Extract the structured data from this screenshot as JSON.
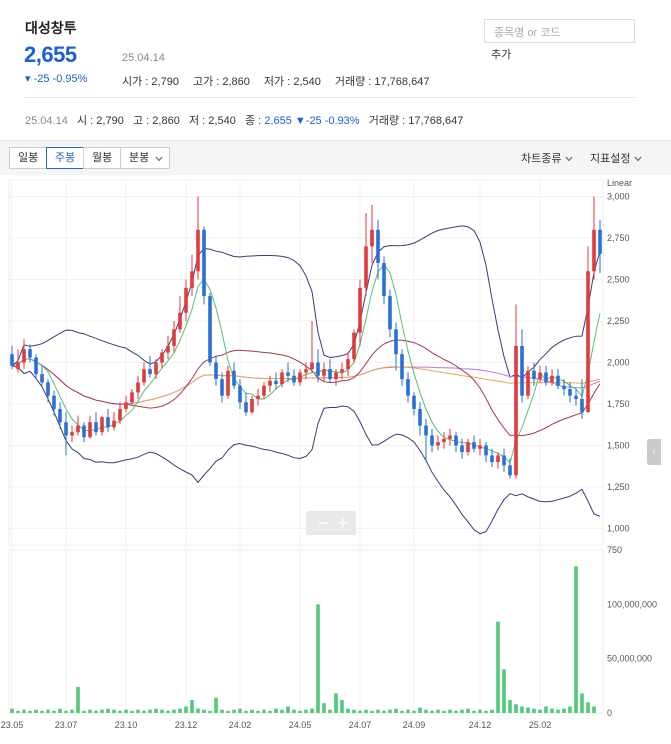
{
  "header": {
    "stock_name": "대성창투",
    "price": "2,655",
    "date": "25.04.14",
    "change": "▾ -25 -0.95%",
    "open_label": "시가 : ",
    "open": "2,790",
    "high_label": "고가 : ",
    "high": "2,860",
    "low_label": "저가 : ",
    "low": "2,540",
    "volume_label": "거래량 : ",
    "volume": "17,768,647",
    "search_placeholder": "종목명 or 코드",
    "add_label": "추가"
  },
  "summary": {
    "date": "25.04.14",
    "open": "시 : 2,790",
    "high": "고 : 2,860",
    "low": "저 : 2,540",
    "close_label": "종 : ",
    "close": "2,655",
    "change": "▼-25 -0.93%",
    "volume": "거래량 : 17,768,647"
  },
  "toolbar": {
    "periods": [
      "일봉",
      "주봉",
      "월봉",
      "분봉"
    ],
    "active_period": "주봉",
    "chart_type": "차트종류",
    "indicator": "지표설정",
    "zoom_out": "−",
    "zoom_in": "+"
  },
  "colors": {
    "up": "#e03a3e",
    "down": "#2a6fd6",
    "volume": "#4fca78",
    "bollinger": "#3b3a7a",
    "ma_short": "#56c070",
    "ma_mid": "#a2394f",
    "ma_long": "#b77be0",
    "ma_xlong": "#f0a35c"
  },
  "chart_data": {
    "type": "candlestick",
    "scale_label": "Linear",
    "price_ticks": [
      "3,000",
      "2,750",
      "2,500",
      "2,250",
      "2,000",
      "1,750",
      "1,500",
      "1,250",
      "1,000"
    ],
    "volume_ticks": [
      "100,000,000",
      "50,000,000",
      "0"
    ],
    "volume_top_label": "750",
    "x_ticks": [
      "23.05",
      "23.07",
      "23.10",
      "23.12",
      "24.02",
      "24.05",
      "24.07",
      "24.09",
      "24.12",
      "25.02"
    ],
    "candles": [
      [
        2050,
        2100,
        1980,
        1960
      ],
      [
        1960,
        2080,
        2000,
        1940
      ],
      [
        2000,
        2140,
        2080,
        1960
      ],
      [
        2080,
        2110,
        2030,
        2000
      ],
      [
        2030,
        2050,
        1930,
        1900
      ],
      [
        1930,
        1980,
        1880,
        1860
      ],
      [
        1880,
        1900,
        1800,
        1760
      ],
      [
        1800,
        1830,
        1720,
        1680
      ],
      [
        1720,
        1760,
        1640,
        1600
      ],
      [
        1640,
        1700,
        1560,
        1440
      ],
      [
        1560,
        1620,
        1580,
        1520
      ],
      [
        1580,
        1680,
        1620,
        1560
      ],
      [
        1620,
        1640,
        1550,
        1520
      ],
      [
        1550,
        1680,
        1640,
        1540
      ],
      [
        1640,
        1700,
        1580,
        1560
      ],
      [
        1580,
        1680,
        1670,
        1560
      ],
      [
        1670,
        1720,
        1610,
        1580
      ],
      [
        1610,
        1700,
        1650,
        1590
      ],
      [
        1650,
        1760,
        1720,
        1630
      ],
      [
        1720,
        1800,
        1760,
        1700
      ],
      [
        1760,
        1840,
        1820,
        1740
      ],
      [
        1820,
        1920,
        1880,
        1780
      ],
      [
        1880,
        2000,
        1960,
        1860
      ],
      [
        1960,
        2040,
        1930,
        1910
      ],
      [
        1930,
        2020,
        2000,
        1900
      ],
      [
        2000,
        2080,
        2060,
        1970
      ],
      [
        2060,
        2160,
        2100,
        2020
      ],
      [
        2100,
        2250,
        2200,
        2060
      ],
      [
        2200,
        2400,
        2300,
        2180
      ],
      [
        2300,
        2500,
        2450,
        2250
      ],
      [
        2450,
        2650,
        2550,
        2400
      ],
      [
        2550,
        3000,
        2800,
        2500
      ],
      [
        2800,
        2820,
        2400,
        2350
      ],
      [
        2400,
        2420,
        2000,
        1980
      ],
      [
        2000,
        2040,
        1900,
        1860
      ],
      [
        1900,
        1940,
        1800,
        1760
      ],
      [
        1800,
        1980,
        1950,
        1780
      ],
      [
        1950,
        2000,
        1860,
        1840
      ],
      [
        1860,
        1900,
        1760,
        1720
      ],
      [
        1760,
        1820,
        1700,
        1680
      ],
      [
        1700,
        1800,
        1780,
        1690
      ],
      [
        1780,
        1840,
        1800,
        1740
      ],
      [
        1800,
        1880,
        1860,
        1780
      ],
      [
        1860,
        1920,
        1890,
        1820
      ],
      [
        1890,
        1940,
        1870,
        1840
      ],
      [
        1870,
        1960,
        1940,
        1850
      ],
      [
        1940,
        2000,
        1920,
        1880
      ],
      [
        1920,
        1960,
        1880,
        1860
      ],
      [
        1880,
        1960,
        1940,
        1860
      ],
      [
        1940,
        2000,
        1960,
        1900
      ],
      [
        1960,
        2250,
        2000,
        1940
      ],
      [
        2000,
        2080,
        1920,
        1880
      ],
      [
        1920,
        2000,
        1960,
        1880
      ],
      [
        1960,
        2020,
        1900,
        1880
      ],
      [
        1900,
        1960,
        1940,
        1860
      ],
      [
        1940,
        2000,
        1960,
        1900
      ],
      [
        1960,
        2060,
        2020,
        1920
      ],
      [
        2020,
        2200,
        2180,
        2000
      ],
      [
        2180,
        2500,
        2450,
        2100
      ],
      [
        2450,
        2900,
        2700,
        2400
      ],
      [
        2700,
        2950,
        2800,
        2600
      ],
      [
        2800,
        2860,
        2600,
        2500
      ],
      [
        2600,
        2640,
        2400,
        2350
      ],
      [
        2400,
        2440,
        2200,
        2150
      ],
      [
        2200,
        2240,
        2050,
        1950
      ],
      [
        2050,
        2080,
        1900,
        1860
      ],
      [
        1900,
        1940,
        1800,
        1760
      ],
      [
        1800,
        1820,
        1720,
        1680
      ],
      [
        1720,
        1760,
        1620,
        1560
      ],
      [
        1620,
        1660,
        1560,
        1400
      ],
      [
        1560,
        1600,
        1500,
        1460
      ],
      [
        1500,
        1560,
        1520,
        1470
      ],
      [
        1520,
        1580,
        1540,
        1480
      ],
      [
        1540,
        1600,
        1560,
        1500
      ],
      [
        1560,
        1580,
        1500,
        1460
      ],
      [
        1500,
        1540,
        1460,
        1420
      ],
      [
        1460,
        1540,
        1520,
        1440
      ],
      [
        1520,
        1560,
        1480,
        1460
      ],
      [
        1480,
        1540,
        1500,
        1440
      ],
      [
        1500,
        1520,
        1440,
        1400
      ],
      [
        1440,
        1480,
        1400,
        1370
      ],
      [
        1400,
        1460,
        1440,
        1360
      ],
      [
        1440,
        1480,
        1380,
        1340
      ],
      [
        1380,
        1420,
        1320,
        1300
      ],
      [
        1320,
        2350,
        2100,
        1300
      ],
      [
        2100,
        2200,
        1800,
        1760
      ],
      [
        1800,
        1980,
        1950,
        1780
      ],
      [
        1950,
        2000,
        1900,
        1860
      ],
      [
        1900,
        1980,
        1940,
        1880
      ],
      [
        1940,
        1980,
        1880,
        1860
      ],
      [
        1880,
        1960,
        1920,
        1860
      ],
      [
        1920,
        1960,
        1860,
        1840
      ],
      [
        1860,
        1900,
        1840,
        1800
      ],
      [
        1840,
        1880,
        1800,
        1760
      ],
      [
        1800,
        1840,
        1780,
        1740
      ],
      [
        1780,
        1900,
        1700,
        1660
      ],
      [
        1700,
        2700,
        2550,
        1700
      ],
      [
        2550,
        3000,
        2800,
        2500
      ],
      [
        2800,
        2860,
        2655,
        2540
      ]
    ],
    "volumes": [
      4,
      2,
      3,
      2,
      3,
      2,
      3,
      2,
      4,
      2,
      3,
      24,
      2,
      3,
      2,
      3,
      4,
      3,
      2,
      3,
      2,
      3,
      2,
      3,
      4,
      3,
      2,
      3,
      4,
      6,
      12,
      4,
      3,
      2,
      14,
      3,
      2,
      3,
      4,
      2,
      3,
      2,
      3,
      2,
      4,
      3,
      6,
      3,
      2,
      3,
      4,
      100,
      9,
      3,
      18,
      12,
      4,
      3,
      2,
      3,
      2,
      3,
      2,
      3,
      4,
      2,
      3,
      2,
      5,
      3,
      2,
      3,
      2,
      3,
      2,
      3,
      4,
      2,
      3,
      2,
      3,
      84,
      40,
      12,
      8,
      6,
      5,
      4,
      3,
      6,
      4,
      3,
      4,
      6,
      135,
      18,
      10,
      6
    ]
  }
}
